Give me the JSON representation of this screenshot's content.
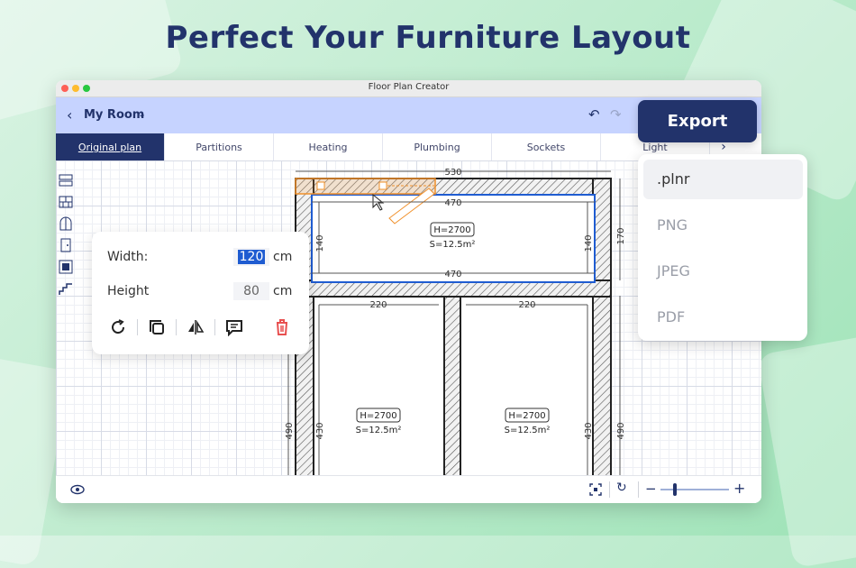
{
  "headline": "Perfect Your Furniture Layout",
  "window": {
    "title": "Floor Plan Creator"
  },
  "toolbar": {
    "room_name": "My Room",
    "export_label": "Export"
  },
  "tabs": [
    "Original plan",
    "Partitions",
    "Heating",
    "Plumbing",
    "Sockets",
    "Light"
  ],
  "tools": [
    "wall-tool-icon",
    "brick-wall-icon",
    "window-arch-icon",
    "door-icon",
    "floor-pattern-icon",
    "stairs-icon"
  ],
  "properties": {
    "width_label": "Width:",
    "width_value": "120",
    "height_label": "Height",
    "height_value": "80",
    "unit": "cm"
  },
  "export_menu": [
    ".plnr",
    "PNG",
    "JPEG",
    "PDF"
  ],
  "plan": {
    "dims": {
      "outer_top": "530",
      "inner_top": "470",
      "inner_bottom": "470",
      "left_side": "140",
      "right_side": "140",
      "right_outer": "170",
      "room_left_top": "220",
      "room_right_top": "220",
      "left_outer_bottom": "490",
      "left_inner_bottom": "430",
      "right_inner_bottom": "430",
      "right_outer_bottom": "490"
    },
    "rooms": [
      {
        "h": "H=2700",
        "s": "S=12.5m²"
      },
      {
        "h": "H=2700",
        "s": "S=12.5m²"
      },
      {
        "h": "H=2700",
        "s": "S=12.5m²"
      }
    ]
  },
  "zoom": {
    "minus": "−",
    "plus": "+",
    "level": 0.2
  },
  "colors": {
    "accent": "#22336b",
    "toolbar": "#c6d3ff",
    "door": "#f0902a",
    "selection": "#1f5cd1",
    "delete": "#e85050"
  }
}
